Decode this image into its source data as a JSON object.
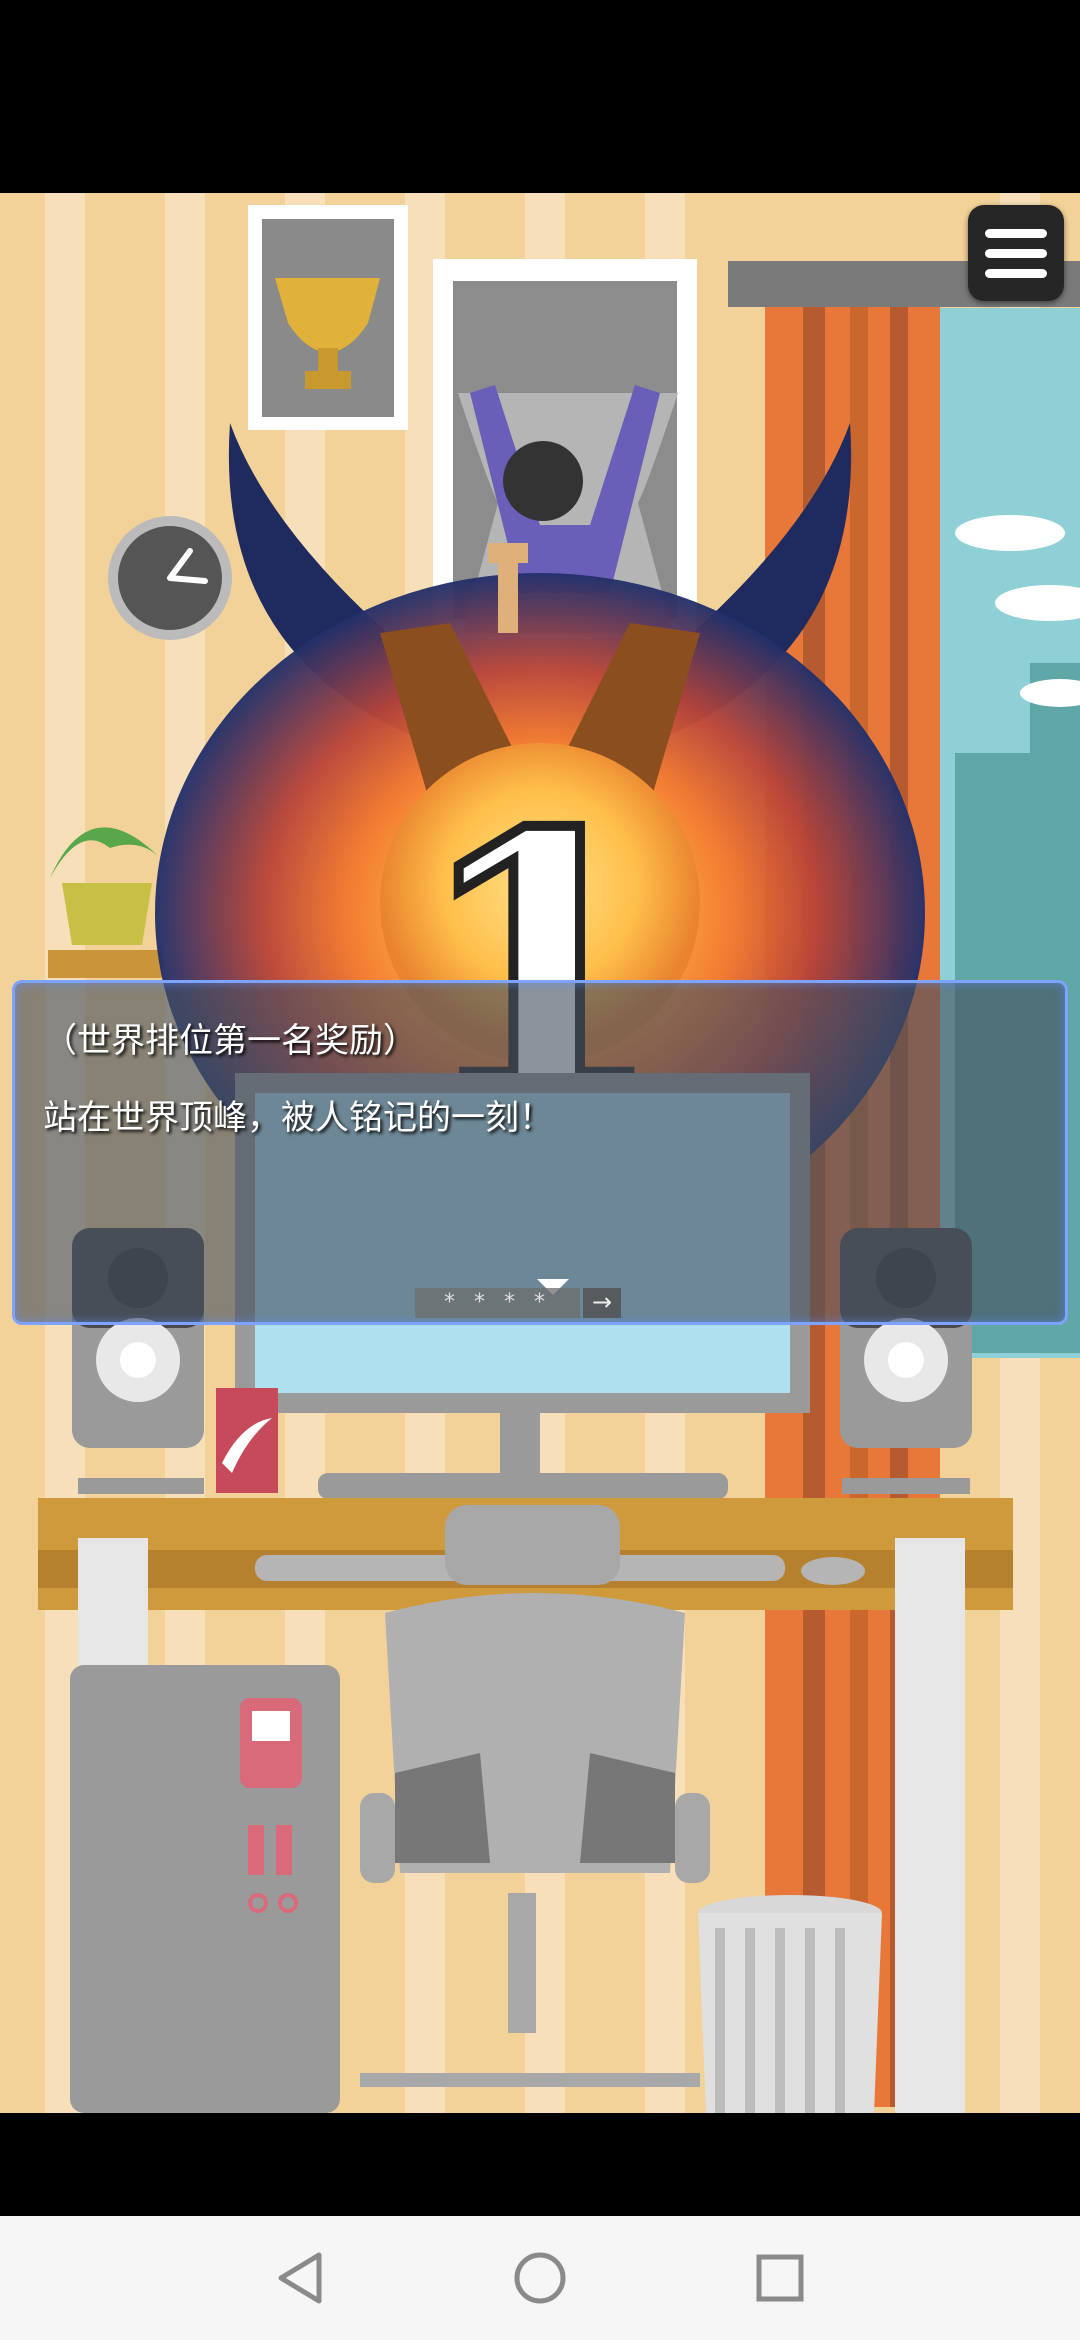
{
  "dialogue": {
    "line1": "（世界排位第一名奖励）",
    "line2": "站在世界顶峰，被人铭记的一刻！"
  },
  "controls": {
    "auto_label": "* * * *",
    "skip_label": "→"
  },
  "award": {
    "rank": "1"
  },
  "icons": {
    "menu": "menu-icon",
    "advance": "triangle-down-icon",
    "back": "back-triangle-icon",
    "home": "home-circle-icon",
    "recents": "recents-square-icon"
  },
  "colors": {
    "wall": "#f3d29a",
    "wall_stripe": "#f6dfb9",
    "curtain": "#e8773a",
    "desk": "#cf9a3c",
    "dialog_border": "#7da3ff",
    "wing": "#1f2b5e"
  }
}
